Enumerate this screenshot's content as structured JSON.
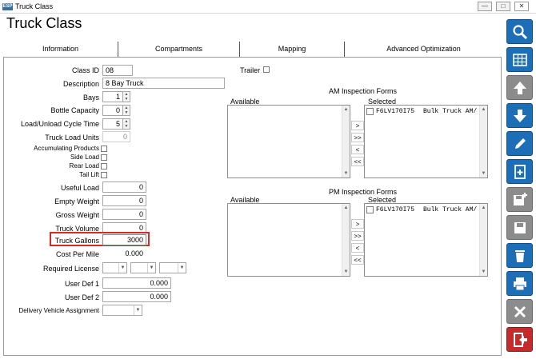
{
  "window": {
    "title": "Truck Class",
    "app_icon_text": "ESP"
  },
  "page_title": "Truck Class",
  "tabs": [
    {
      "label": "Information"
    },
    {
      "label": "Compartments"
    },
    {
      "label": "Mapping"
    },
    {
      "label": "Advanced Optimization"
    }
  ],
  "form": {
    "class_id": {
      "label": "Class ID",
      "value": "08"
    },
    "trailer": {
      "label": "Trailer",
      "checked": false
    },
    "description": {
      "label": "Description",
      "value": "8 Bay Truck"
    },
    "bays": {
      "label": "Bays",
      "value": "1"
    },
    "bottle_capacity": {
      "label": "Bottle Capacity",
      "value": "0"
    },
    "cycle_time": {
      "label": "Load/Unload Cycle Time",
      "value": "5"
    },
    "truck_load_units": {
      "label": "Truck Load Units",
      "value": "0"
    },
    "accumulating_products": {
      "label": "Accumulating Products",
      "checked": false
    },
    "side_load": {
      "label": "Side Load",
      "checked": false
    },
    "rear_load": {
      "label": "Rear Load",
      "checked": false
    },
    "tail_lift": {
      "label": "Tail Lift",
      "checked": false
    },
    "useful_load": {
      "label": "Useful Load",
      "value": "0"
    },
    "empty_weight": {
      "label": "Empty Weight",
      "value": "0"
    },
    "gross_weight": {
      "label": "Gross Weight",
      "value": "0"
    },
    "truck_volume": {
      "label": "Truck Volume",
      "value": "0"
    },
    "truck_gallons": {
      "label": "Truck Gallons",
      "value": "3000"
    },
    "cost_per_mile": {
      "label": "Cost Per Mile",
      "value": "0.000"
    },
    "required_license": {
      "label": "Required License",
      "values": [
        "",
        "",
        ""
      ]
    },
    "user_def_1": {
      "label": "User Def 1",
      "value": "0.000"
    },
    "user_def_2": {
      "label": "User Def 2",
      "value": "0.000"
    },
    "delivery_vehicle_assignment": {
      "label": "Delivery Vehicle Assignment",
      "value": ""
    }
  },
  "am_inspection": {
    "title": "AM Inspection Forms",
    "available_label": "Available",
    "selected_label": "Selected",
    "selected_items": [
      {
        "code": "F6LV170I75",
        "name": "Bulk Truck AM/"
      }
    ],
    "buttons": [
      ">",
      ">>",
      "<",
      "<<"
    ]
  },
  "pm_inspection": {
    "title": "PM Inspection Forms",
    "available_label": "Available",
    "selected_label": "Selected",
    "selected_items": [
      {
        "code": "F6LV170I75",
        "name": "Bulk Truck AM/"
      }
    ],
    "buttons": [
      ">",
      ">>",
      "<",
      "<<"
    ]
  },
  "toolbar_icons": [
    "search-icon",
    "grid-icon",
    "arrow-up-icon",
    "arrow-down-icon",
    "pencil-icon",
    "new-document-icon",
    "save-new-icon",
    "save-icon",
    "delete-icon",
    "print-icon",
    "close-x-icon",
    "exit-icon"
  ],
  "colors": {
    "accent_blue": "#1c6fb7",
    "highlight_red": "#d42a2a",
    "disabled_gray": "#8c8c8c",
    "exit_red": "#c42b2b"
  }
}
